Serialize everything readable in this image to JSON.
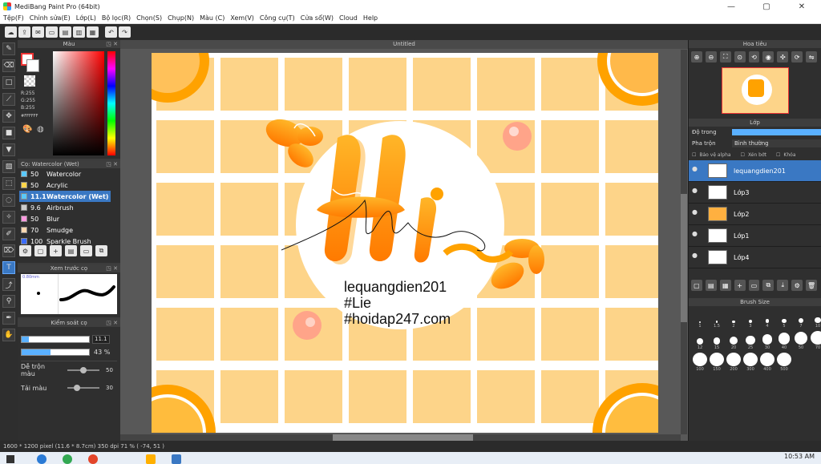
{
  "window": {
    "title": "MediBang Paint Pro (64bit)",
    "min": "—",
    "max": "▢",
    "close": "✕"
  },
  "menu": [
    "Tệp(F)",
    "Chỉnh sửa(E)",
    "Lớp(L)",
    "Bộ lọc(R)",
    "Chọn(S)",
    "Chụp(N)",
    "Màu (C)",
    "Xem(V)",
    "Công cụ(T)",
    "Cửa sổ(W)",
    "Cloud",
    "Help"
  ],
  "color_panel": {
    "title": "Màu",
    "r": "R:255",
    "g": "G:255",
    "b": "B:255",
    "hex": "#FFFFFF"
  },
  "brush_panel": {
    "title": "Cọ: Watercolor (Wet)",
    "brushes": [
      {
        "size": "50",
        "name": "Watercolor",
        "color": "#5ac8fa"
      },
      {
        "size": "50",
        "name": "Acrylic",
        "color": "#ffd54a"
      },
      {
        "size": "11.1",
        "name": "Watercolor (Wet)",
        "color": "#5ac8fa",
        "selected": true
      },
      {
        "size": "9.6",
        "name": "Airbrush",
        "color": "#cccccc"
      },
      {
        "size": "50",
        "name": "Blur",
        "color": "#ff9ae0"
      },
      {
        "size": "70",
        "name": "Smudge",
        "color": "#ffd8b0"
      },
      {
        "size": "100",
        "name": "Sparkle Brush",
        "color": "#3a6cff"
      }
    ]
  },
  "preview_panel": {
    "title": "Xem trước cọ",
    "size": "0.80mm"
  },
  "brush_control": {
    "title": "Kiểm soát cọ",
    "size_value": "11.1",
    "size_fill": 0.11,
    "opacity_label": "43 %",
    "opacity_fill": 0.43,
    "blend_label": "Dễ trộn màu",
    "blend_value": "50",
    "blend_level": 0.5,
    "load_label": "Tải màu",
    "load_value": "30",
    "load_level": 0.3
  },
  "document": {
    "tab": "Untitled",
    "lines": [
      "lequangdien201",
      "#Lie",
      "#hoidap247.com"
    ]
  },
  "navigator": {
    "title": "Hoa tiêu"
  },
  "layer_panel": {
    "title": "Lớp",
    "opacity_label": "Độ trong",
    "blend_label": "Pha trộn",
    "blend_value": "Bình thường",
    "protect_label": "Bảo vệ alpha",
    "clip_label": "Xén bớt",
    "lock_label": "Khóa",
    "layers": [
      {
        "name": "lequangdien201",
        "selected": true
      },
      {
        "name": "Lớp3"
      },
      {
        "name": "Lớp2"
      },
      {
        "name": "Lớp1"
      },
      {
        "name": "Lớp4"
      }
    ]
  },
  "brush_size": {
    "title": "Brush Size",
    "sizes": [
      "1",
      "1.5",
      "2",
      "3",
      "4",
      "5",
      "7",
      "10",
      "12",
      "15",
      "20",
      "25",
      "30",
      "40",
      "50",
      "70",
      "100",
      "150",
      "200",
      "300",
      "400",
      "500"
    ]
  },
  "status": {
    "text": "1600 * 1200 pixel  (11.6 * 8.7cm)  350 dpi  71 %  ( -74, 51 )"
  },
  "taskbar": {
    "time": "10:53 AM"
  }
}
